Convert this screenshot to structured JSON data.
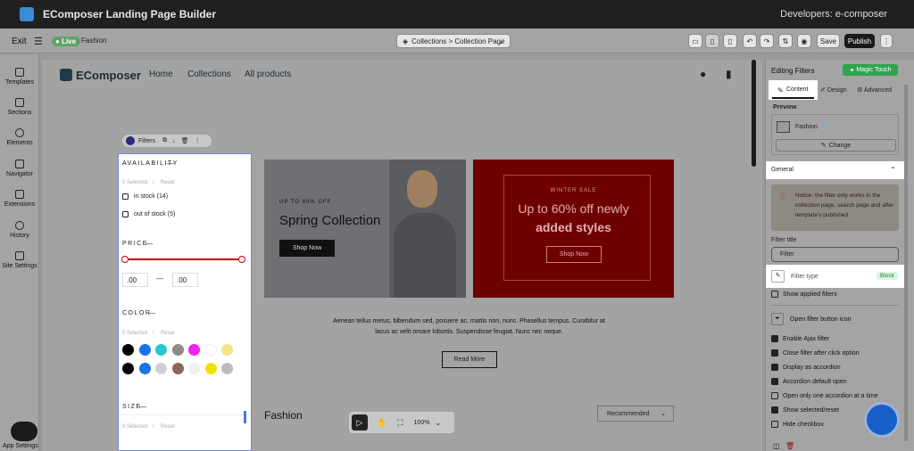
{
  "titlebar": {
    "title": "EComposer Landing Page Builder",
    "developers": "Developers:  e-composer"
  },
  "toolbar": {
    "exit": "Exit",
    "live": "Live",
    "page_name": "Fashion",
    "breadcrumb": "Collections > Collection Page",
    "save": "Save",
    "publish": "Publish"
  },
  "leftbar": {
    "items": [
      "Templates",
      "Sections",
      "Elements",
      "Navigator",
      "Extensions",
      "History",
      "Site Settings"
    ],
    "app_settings": "App Settings"
  },
  "store": {
    "brand": "EComposer",
    "nav": [
      "Home",
      "Collections",
      "All products"
    ],
    "filters_tag": "Filters",
    "availability": {
      "title": "AVAILABILITY",
      "selected": "0 Selected",
      "reset": "Reset",
      "options": [
        "in stock (14)",
        "out of stock (5)"
      ]
    },
    "price": {
      "title": "PRICE",
      "min": ".00",
      "dash": "—",
      "max": ".00"
    },
    "color": {
      "title": "COLOR",
      "selected": "0 Selected",
      "reset": "Reset",
      "swatches": [
        "#000000",
        "#1a73e8",
        "#29c4cf",
        "#8a8a8a",
        "#ee22ee",
        "#ffffff",
        "#f6e08c",
        "#000000",
        "#1a73e8",
        "#cfcfcf",
        "#8b6659",
        "#f2f2f2",
        "#f0e000",
        "#bcbcbc"
      ]
    },
    "size": {
      "title": "SIZE",
      "selected": "0 Selected",
      "reset": "Reset"
    },
    "banner1": {
      "eyebrow": "UP TO 60% OFF",
      "heading": "Spring Collection",
      "button": "Shop Now"
    },
    "banner2": {
      "eyebrow": "WINTER SALE",
      "line1": "Up to 60% off newly",
      "line2": "added styles",
      "button": "Shop Now"
    },
    "paragraph_1": "Aenean tellus metus, bibendum sed, posuere ac, mattis non, nunc. Phasellus tempus. Curabitur at",
    "paragraph_2": "lacus ac velit ornare lobortis. Suspendisse feugiat. Nunc nec neque.",
    "read_more": "Read More",
    "collection_title": "Fashion",
    "sort": "Recommended",
    "zoom": "100%"
  },
  "panel": {
    "title": "Editing Filters",
    "magic": "Magic Touch",
    "tabs": [
      "Content",
      "Design",
      "Advanced"
    ],
    "preview_label": "Preview",
    "preview_name": "Fashion",
    "change": "Change",
    "general": "General",
    "notice": "Notice: the filter only works in the collection page, search page and after template's published",
    "filter_title_label": "Filter title",
    "filter_title_value": "Filter",
    "filter_type_label": "Filter type",
    "filter_type_value": "Block",
    "show_applied": "Show applied filters",
    "open_icon": "Open filter button icon",
    "options": [
      {
        "label": "Enable Ajax filter",
        "on": true
      },
      {
        "label": "Close filter after click option",
        "on": true
      },
      {
        "label": "Display as accordion",
        "on": true
      },
      {
        "label": "Accordion default open",
        "on": true
      },
      {
        "label": "Open only one accordion at a time",
        "on": false
      },
      {
        "label": "Show selected/reset",
        "on": true
      },
      {
        "label": "Hide checkbox",
        "on": false
      }
    ]
  },
  "colors": {
    "accent_red": "#c00000",
    "live_green": "#5fa266",
    "magic_green": "#2ea44f"
  }
}
